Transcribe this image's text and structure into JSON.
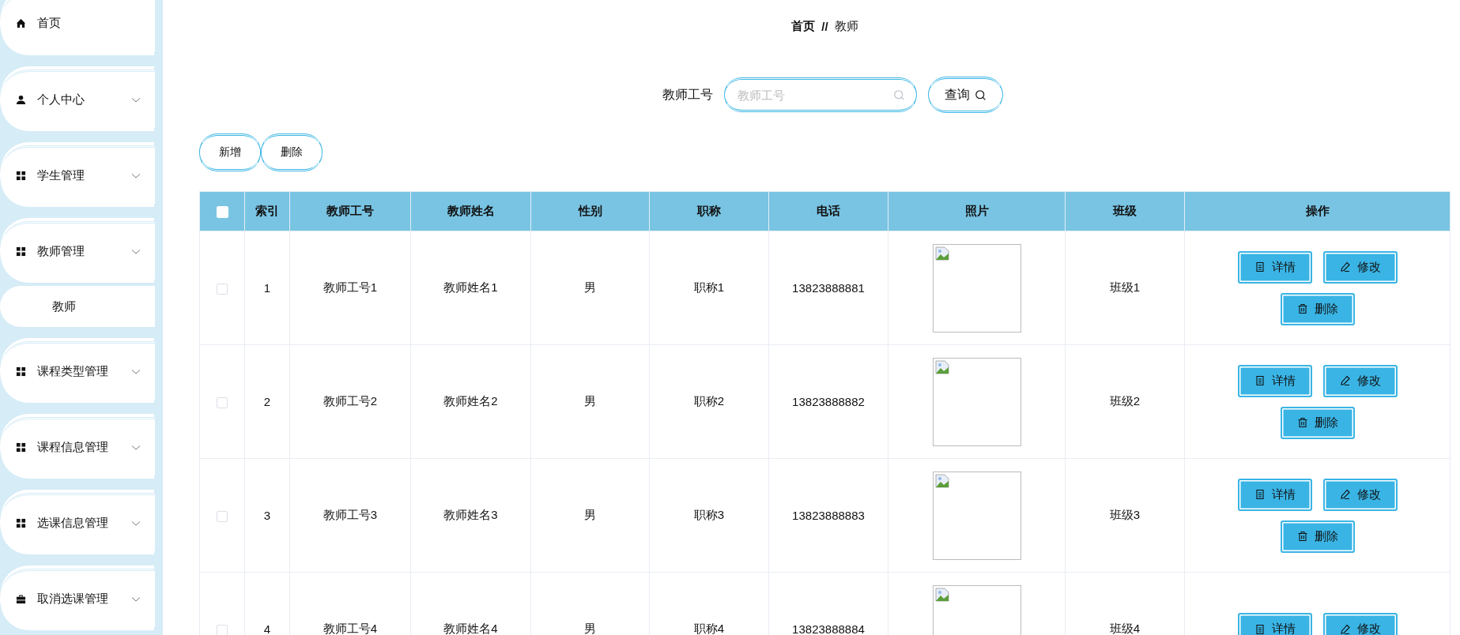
{
  "sidebar": {
    "items": [
      {
        "label": "首页",
        "kind": "link"
      },
      {
        "label": "个人中心",
        "kind": "menu"
      },
      {
        "label": "学生管理",
        "kind": "menu"
      },
      {
        "label": "教师管理",
        "kind": "menu",
        "children": [
          {
            "label": "教师"
          }
        ]
      },
      {
        "label": "课程类型管理",
        "kind": "menu"
      },
      {
        "label": "课程信息管理",
        "kind": "menu"
      },
      {
        "label": "选课信息管理",
        "kind": "menu"
      },
      {
        "label": "取消选课管理",
        "kind": "menu"
      }
    ]
  },
  "breadcrumb": {
    "items": [
      "首页",
      "教师"
    ],
    "separator": "//"
  },
  "search": {
    "label": "教师工号",
    "placeholder": "教师工号",
    "button": "查询"
  },
  "toolbar": {
    "buttons": [
      "新增",
      "删除"
    ]
  },
  "table": {
    "select_all_checked": false,
    "columns": [
      "索引",
      "教师工号",
      "教师姓名",
      "性别",
      "职称",
      "电话",
      "照片",
      "班级",
      "操作"
    ],
    "rows": [
      {
        "checked": false,
        "cells": [
          "1",
          "教师工号1",
          "教师姓名1",
          "男",
          "职称1",
          "13823888881",
          "班级1"
        ],
        "actions": [
          {
            "kind": "detail",
            "label": "详情"
          },
          {
            "kind": "edit",
            "label": "修改"
          },
          {
            "kind": "delete",
            "label": "删除"
          }
        ]
      },
      {
        "checked": false,
        "cells": [
          "2",
          "教师工号2",
          "教师姓名2",
          "男",
          "职称2",
          "13823888882",
          "班级2"
        ],
        "actions": [
          {
            "kind": "detail",
            "label": "详情"
          },
          {
            "kind": "edit",
            "label": "修改"
          },
          {
            "kind": "delete",
            "label": "删除"
          }
        ]
      },
      {
        "checked": false,
        "cells": [
          "3",
          "教师工号3",
          "教师姓名3",
          "男",
          "职称3",
          "13823888883",
          "班级3"
        ],
        "actions": [
          {
            "kind": "detail",
            "label": "详情"
          },
          {
            "kind": "edit",
            "label": "修改"
          },
          {
            "kind": "delete",
            "label": "删除"
          }
        ]
      },
      {
        "checked": false,
        "cells": [
          "4",
          "教师工号4",
          "教师姓名4",
          "男",
          "职称4",
          "13823888884",
          "班级4"
        ],
        "actions": [
          {
            "kind": "detail",
            "label": "详情"
          },
          {
            "kind": "edit",
            "label": "修改"
          }
        ]
      }
    ]
  }
}
